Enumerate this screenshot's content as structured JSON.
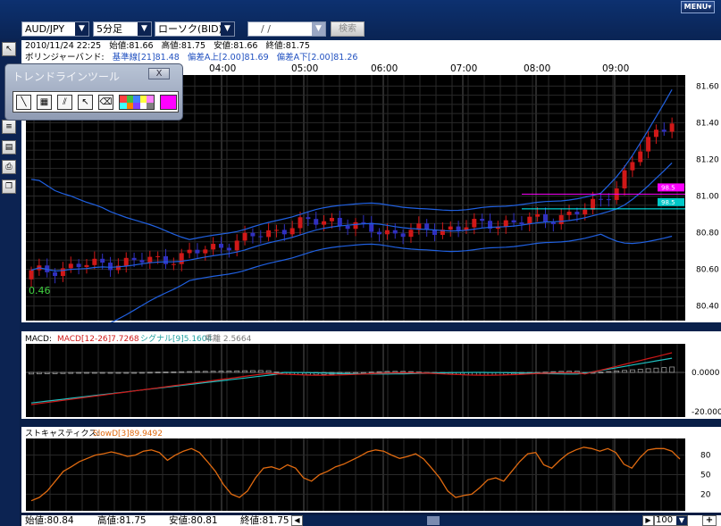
{
  "toolbar": {
    "symbol": "AUD/JPY",
    "interval": "5分足",
    "price_type": "ローソク(BID)",
    "date_placeholder": "/ /",
    "search_label": "検索",
    "menu_label": "MENU"
  },
  "info": {
    "datetime": "2010/11/24 22:25",
    "open": "始値:81.66",
    "high": "高値:81.75",
    "low": "安値:81.66",
    "close": "終値:81.75",
    "bb_label": "ボリンジャーバンド:",
    "bb_base": "基準線[21]81.48",
    "bb_upper": "偏差A上[2.00]81.69",
    "bb_lower": "偏差A下[2.00]81.26"
  },
  "trend_tool": {
    "title": "トレンドラインツール",
    "close_label": "X",
    "selected_color": "#ff00ff",
    "palette": [
      "#ff4040",
      "#40c040",
      "#4080ff",
      "#ffff40",
      "#ff80ff",
      "#40ffff",
      "#ff8000",
      "#8040ff",
      "#ffffff",
      "#808080"
    ]
  },
  "colors": {
    "up_candle": "#d01818",
    "down_candle": "#3030c0",
    "bb_line": "#2060e0",
    "macd_line": "#d01818",
    "signal_line": "#20c0c0",
    "stoch_line": "#e06a10",
    "grid": "#3a3a3a"
  },
  "price_chart": {
    "time_labels": [
      "04:00",
      "05:00",
      "06:00",
      "07:00",
      "08:00",
      "09:00"
    ],
    "y_ticks": [
      "81.60",
      "81.40",
      "81.20",
      "81.00",
      "80.80",
      "80.60",
      "80.40"
    ],
    "y_tick_values": [
      81.6,
      81.4,
      81.2,
      81.0,
      80.8,
      80.6,
      80.4
    ],
    "ylim": [
      80.32,
      81.66
    ],
    "marker_label": "0.46",
    "magenta_line": "81.01",
    "teal_line": "80.93",
    "magenta_tag": "98.5",
    "teal_tag": "98.5"
  },
  "macd": {
    "label": "MACD:",
    "macd": "MACD[12-26]7.7268",
    "signal": "シグナル[9]5.1604",
    "divergence": "乖離 2.5664",
    "y_ticks": [
      "0.0000",
      "-20.0000"
    ]
  },
  "stoch": {
    "label": "ストキャスティクス:",
    "slow": "SlowD[3]89.9492",
    "y_ticks": [
      "80",
      "50",
      "20"
    ]
  },
  "status": {
    "open": "始値:80.84",
    "high": "高値:81.75",
    "low": "安値:80.81",
    "close": "終値:81.75",
    "zoom": "100"
  }
}
